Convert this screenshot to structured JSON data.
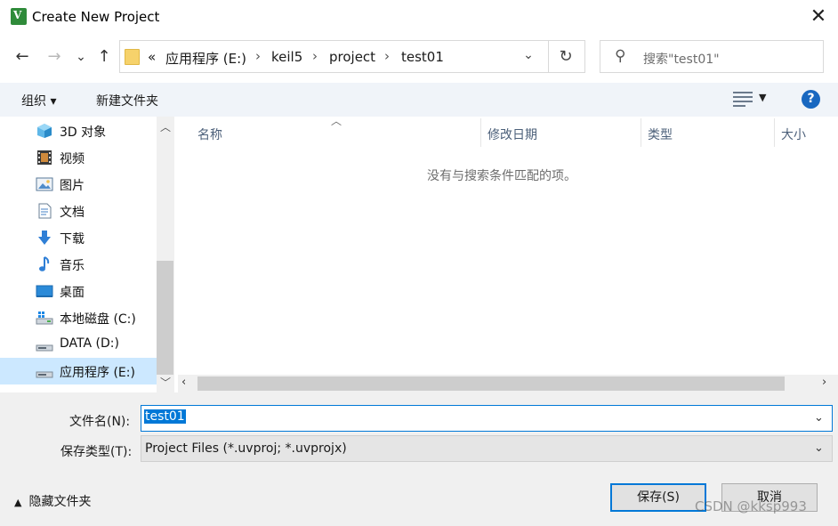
{
  "window": {
    "title": "Create New Project",
    "app_icon_letter": "V"
  },
  "nav": {
    "back": "←",
    "forward": "→",
    "recent": "⌄",
    "up": "↑"
  },
  "address": {
    "overflow": "«",
    "crumbs": [
      "应用程序 (E:)",
      "keil5",
      "project",
      "test01"
    ],
    "separator": "›"
  },
  "search": {
    "placeholder": "搜索\"test01\""
  },
  "toolbar": {
    "organize": "组织 ▾",
    "new_folder": "新建文件夹",
    "help": "?"
  },
  "sidebar": {
    "items": [
      {
        "label": "3D 对象",
        "icon": "3d-objects-icon"
      },
      {
        "label": "视频",
        "icon": "video-icon"
      },
      {
        "label": "图片",
        "icon": "pictures-icon"
      },
      {
        "label": "文档",
        "icon": "documents-icon"
      },
      {
        "label": "下载",
        "icon": "downloads-icon"
      },
      {
        "label": "音乐",
        "icon": "music-icon"
      },
      {
        "label": "桌面",
        "icon": "desktop-icon"
      },
      {
        "label": "本地磁盘 (C:)",
        "icon": "drive-c-icon"
      },
      {
        "label": "DATA (D:)",
        "icon": "drive-d-icon"
      },
      {
        "label": "应用程序 (E:)",
        "icon": "drive-e-icon",
        "selected": true
      }
    ]
  },
  "list": {
    "columns": [
      "名称",
      "修改日期",
      "类型",
      "大小"
    ],
    "empty_message": "没有与搜索条件匹配的项。"
  },
  "form": {
    "filename_label": "文件名(N):",
    "filename_value": "test01",
    "filetype_label": "保存类型(T):",
    "filetype_value": "Project Files (*.uvproj; *.uvprojx)"
  },
  "footer": {
    "hide_folders": "隐藏文件夹",
    "save": "保存(S)",
    "cancel": "取消"
  },
  "watermark": "CSDN @kksp993"
}
